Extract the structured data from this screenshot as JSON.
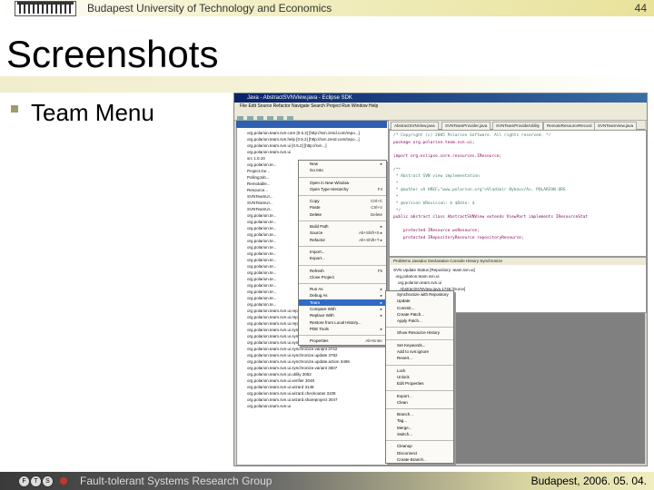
{
  "header": {
    "university": "Budapest University of Technology and Economics",
    "page_number": "44"
  },
  "slide": {
    "title": "Screenshots",
    "bullet": "Team Menu"
  },
  "footer": {
    "group": "Fault-tolerant Systems Research Group",
    "date": "Budapest, 2006. 05. 04."
  },
  "ide": {
    "window_title": "Java - AbstractSVNView.java - Eclipse SDK",
    "menubar": "File  Edit  Source  Refactor  Navigate  Search  Project  Run  Window  Help",
    "nav_tabs": [
      "Package Explorer",
      "Hierarchy"
    ],
    "editor_tabs": [
      "AbstractSVNView.java",
      "SVNTeamProvider.java",
      "SVNTeamProviderUtility",
      "RemoteResourceRecord",
      "SVNTeamView.java"
    ],
    "tree_rows": [
      "org.polarion.team.svn.core [0.5.2] [http://svn.zend.com/repo...]",
      "org.polarion.team.svn.help [0.5.2] [http://svn.zend.com/repo...]",
      "org.polarion.team.svn.ui [0.5.2] [http://svn...]",
      "org.polarion.team.svn.ui",
      "src 1.0.10",
      "org.polarion.te...",
      "Project.Ge...",
      "PollingJob...",
      "Remotable...",
      "Resource...",
      "SVNTeamUI...",
      "SVNTeamUI...",
      "SVNTeamUI...",
      "org.polarion.te...",
      "org.polarion.te...",
      "org.polarion.te...",
      "org.polarion.te...",
      "org.polarion.te...",
      "org.polarion.te...",
      "org.polarion.te...",
      "org.polarion.te...",
      "org.polarion.te...",
      "org.polarion.te...",
      "org.polarion.te...",
      "org.polarion.te...",
      "org.polarion.te...",
      "org.polarion.te...",
      "org.polarion.te...",
      "org.polarion.team.svn.ui.repository 3052",
      "org.polarion.team.svn.ui.repository.browser 3085",
      "org.polarion.team.svn.ui.repository.model 3782",
      "org.polarion.team.svn.ui.synchronize 3782",
      "org.polarion.team.svn.ui.synchronize.action 3778",
      "org.polarion.team.svn.ui.synchronize.action.logic 3742",
      "org.polarion.team.svn.ui.synchronize.variant 3742",
      "org.polarion.team.svn.ui.synchronize.update 3782",
      "org.polarion.team.svn.ui.synchronize.update.action 3496",
      "org.polarion.team.svn.ui.synchronize.variant 3507",
      "org.polarion.team.svn.ui.utility 3052",
      "org.polarion.team.svn.ui.verifier 3048",
      "org.polarion.team.svn.ui.wizard 3148",
      "org.polarion.team.svn.ui.wizard.checkoutas 3108",
      "org.polarion.team.svn.ui.wizard.shareproject 3047",
      "org.polarion.team.svn.ui"
    ],
    "code_lines": [
      "/* Copyright (c) 2005 Polarion Software. All rights reserved. */",
      "package org.polarion.team.svn.ui;",
      "",
      "import org.eclipse.core.resources.IResource;",
      "",
      "/**",
      " * Abstract SVN view implementation",
      " *",
      " * @author <A HREF=\"www.polarion.org\">Vladimir Bykov</A>, POLARION.ORG",
      " *",
      " * @version $Revision: $ $Date: $",
      " */",
      "public abstract class AbstractSVNView extends ViewPart implements IResourceStat",
      "",
      "    protected IResource wsResource;",
      "    protected IRepositoryResource repositoryResource;"
    ],
    "bottom_tabs": "Problems  Javadoc  Declaration  Console  History  Synchronize",
    "bottom_lines": [
      "SVN Update Status [Repository: team.svn.ui]",
      "  org.polarion.team.svn.ui",
      "    org.polarion.team.svn.ui",
      "      AbstractSVNView.java 1746 [Gurov]",
      "      org.polarion.team.svn.ui.action",
      "      org.polarion.team.svn.ui.dialog"
    ],
    "context_menu": [
      {
        "label": "New",
        "acc": "▸"
      },
      {
        "label": "Go Into",
        "acc": ""
      },
      {
        "sep": true
      },
      {
        "label": "Open in New Window",
        "acc": ""
      },
      {
        "label": "Open Type Hierarchy",
        "acc": "F4"
      },
      {
        "sep": true
      },
      {
        "label": "Copy",
        "acc": "Ctrl+C"
      },
      {
        "label": "Paste",
        "acc": "Ctrl+V"
      },
      {
        "label": "Delete",
        "acc": "Delete"
      },
      {
        "sep": true
      },
      {
        "label": "Build Path",
        "acc": "▸"
      },
      {
        "label": "Source",
        "acc": "Alt+Shift+S ▸"
      },
      {
        "label": "Refactor",
        "acc": "Alt+Shift+T ▸"
      },
      {
        "sep": true
      },
      {
        "label": "Import...",
        "acc": ""
      },
      {
        "label": "Export...",
        "acc": ""
      },
      {
        "sep": true
      },
      {
        "label": "Refresh",
        "acc": "F5"
      },
      {
        "label": "Close Project",
        "acc": ""
      },
      {
        "sep": true
      },
      {
        "label": "Run As",
        "acc": "▸"
      },
      {
        "label": "Debug As",
        "acc": "▸"
      },
      {
        "label": "Team",
        "acc": "▸",
        "hl": true
      },
      {
        "label": "Compare With",
        "acc": "▸"
      },
      {
        "label": "Replace With",
        "acc": "▸"
      },
      {
        "label": "Restore from Local History...",
        "acc": ""
      },
      {
        "label": "PDE Tools",
        "acc": "▸"
      },
      {
        "sep": true
      },
      {
        "label": "Properties",
        "acc": "Alt+Enter"
      }
    ],
    "team_menu": [
      {
        "label": "Synchronize with Repository",
        "acc": ""
      },
      {
        "label": "Update",
        "acc": ""
      },
      {
        "label": "Commit...",
        "acc": ""
      },
      {
        "label": "Create Patch...",
        "acc": ""
      },
      {
        "label": "Apply Patch...",
        "acc": ""
      },
      {
        "sep": true
      },
      {
        "label": "Show Resource History",
        "acc": ""
      },
      {
        "sep": true
      },
      {
        "label": "Set Keywords...",
        "acc": ""
      },
      {
        "label": "Add to svn:ignore",
        "acc": ""
      },
      {
        "label": "Revert...",
        "acc": ""
      },
      {
        "sep": true
      },
      {
        "label": "Lock",
        "acc": ""
      },
      {
        "label": "Unlock",
        "acc": ""
      },
      {
        "label": "Edit Properties",
        "acc": ""
      },
      {
        "sep": true
      },
      {
        "label": "Export...",
        "acc": ""
      },
      {
        "label": "Clean",
        "acc": ""
      },
      {
        "sep": true
      },
      {
        "label": "Branch...",
        "acc": ""
      },
      {
        "label": "Tag...",
        "acc": ""
      },
      {
        "label": "Merge...",
        "acc": ""
      },
      {
        "label": "Switch...",
        "acc": ""
      },
      {
        "sep": true
      },
      {
        "label": "Cleanup",
        "acc": ""
      },
      {
        "label": "Disconnect",
        "acc": ""
      },
      {
        "label": "Create Branch...",
        "acc": ""
      }
    ]
  }
}
